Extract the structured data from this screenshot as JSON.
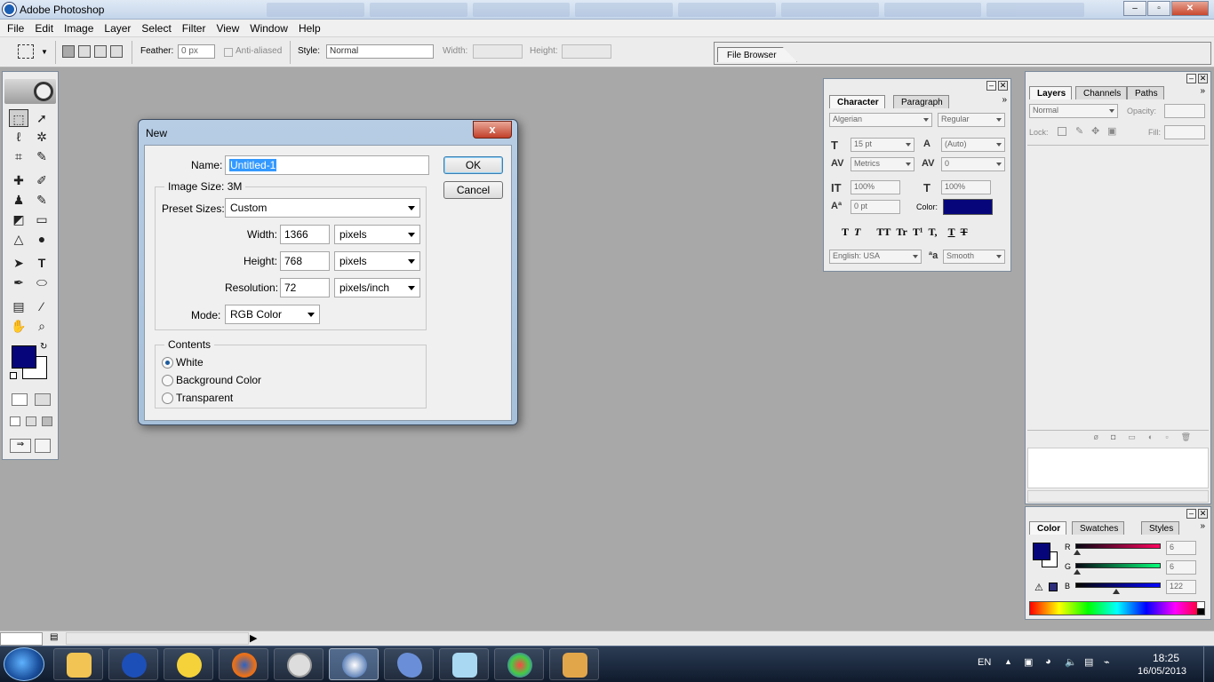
{
  "app": {
    "title": "Adobe Photoshop"
  },
  "menu": [
    "File",
    "Edit",
    "Image",
    "Layer",
    "Select",
    "Filter",
    "View",
    "Window",
    "Help"
  ],
  "options": {
    "feather_label": "Feather:",
    "feather_value": "0 px",
    "antialias_label": "Anti-aliased",
    "style_label": "Style:",
    "style_value": "Normal",
    "width_label": "Width:",
    "height_label": "Height:",
    "file_browser_tab": "File Browser"
  },
  "dialog": {
    "title": "New",
    "close": "x",
    "name_label": "Name:",
    "name_value": "Untitled-1",
    "ok": "OK",
    "cancel": "Cancel",
    "image_size": "Image Size: 3M",
    "preset_label": "Preset Sizes:",
    "preset_value": "Custom",
    "width_label": "Width:",
    "width_value": "1366",
    "width_unit": "pixels",
    "height_label": "Height:",
    "height_value": "768",
    "height_unit": "pixels",
    "resolution_label": "Resolution:",
    "resolution_value": "72",
    "resolution_unit": "pixels/inch",
    "mode_label": "Mode:",
    "mode_value": "RGB Color",
    "contents_label": "Contents",
    "contents_options": [
      "White",
      "Background Color",
      "Transparent"
    ],
    "contents_selected": 0
  },
  "character": {
    "tabs": [
      "Character",
      "Paragraph"
    ],
    "font": "Algerian",
    "style": "Regular",
    "size": "15 pt",
    "leading": "(Auto)",
    "kerning": "Metrics",
    "tracking": "0",
    "vscale": "100%",
    "hscale": "100%",
    "baseline": "0 pt",
    "color_label": "Color:",
    "language": "English: USA",
    "antialias": "Smooth",
    "type_buttons": [
      "T",
      "T",
      "TT",
      "Tr",
      "T¹",
      "T,",
      "T",
      "T"
    ]
  },
  "layers": {
    "tabs": [
      "Layers",
      "Channels",
      "Paths"
    ],
    "blend": "Normal",
    "opacity_label": "Opacity:",
    "lock_label": "Lock:",
    "fill_label": "Fill:"
  },
  "color_panel": {
    "tabs": [
      "Color",
      "Swatches",
      "Styles"
    ],
    "channels": [
      {
        "label": "R",
        "value": "6",
        "fraction": 0.024
      },
      {
        "label": "G",
        "value": "6",
        "fraction": 0.024
      },
      {
        "label": "B",
        "value": "122",
        "fraction": 0.478
      }
    ]
  },
  "colors": {
    "foreground": "#06067a",
    "background": "#ffffff",
    "canvas": "#a8a8a8"
  },
  "tray": {
    "lang": "EN",
    "time": "18:25",
    "date": "16/05/2013"
  },
  "taskbar_apps": [
    "explorer",
    "3g-connect",
    "yahoo-messenger",
    "firefox",
    "safari",
    "photoshop",
    "dolphin-app",
    "notes-app",
    "paint-app",
    "reader-app"
  ]
}
